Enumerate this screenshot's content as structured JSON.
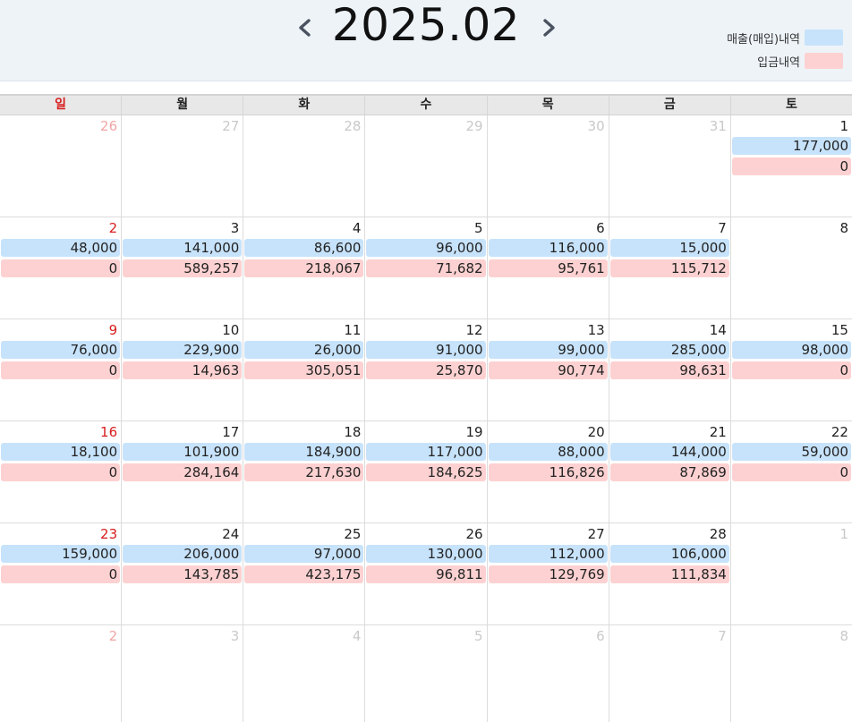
{
  "header": {
    "title": "2025.02",
    "prev_icon": "chevron-left-icon",
    "next_icon": "chevron-right-icon"
  },
  "legend": [
    {
      "label": "매출(매입)내역",
      "color": "#c7e3fb"
    },
    {
      "label": "입금내역",
      "color": "#fdd1d1"
    }
  ],
  "weekdays": [
    "일",
    "월",
    "화",
    "수",
    "목",
    "금",
    "토"
  ],
  "colors": {
    "sales": "#c7e3fb",
    "deposit": "#fdd1d1",
    "sunday": "#d71d1d"
  },
  "weeks": [
    [
      {
        "day": "26",
        "other": true
      },
      {
        "day": "27",
        "other": true
      },
      {
        "day": "28",
        "other": true
      },
      {
        "day": "29",
        "other": true
      },
      {
        "day": "30",
        "other": true
      },
      {
        "day": "31",
        "other": true
      },
      {
        "day": "1",
        "sales": "177,000",
        "deposit": "0"
      }
    ],
    [
      {
        "day": "2",
        "sales": "48,000",
        "deposit": "0"
      },
      {
        "day": "3",
        "sales": "141,000",
        "deposit": "589,257"
      },
      {
        "day": "4",
        "sales": "86,600",
        "deposit": "218,067"
      },
      {
        "day": "5",
        "sales": "96,000",
        "deposit": "71,682"
      },
      {
        "day": "6",
        "sales": "116,000",
        "deposit": "95,761"
      },
      {
        "day": "7",
        "sales": "15,000",
        "deposit": "115,712"
      },
      {
        "day": "8"
      }
    ],
    [
      {
        "day": "9",
        "sales": "76,000",
        "deposit": "0"
      },
      {
        "day": "10",
        "sales": "229,900",
        "deposit": "14,963"
      },
      {
        "day": "11",
        "sales": "26,000",
        "deposit": "305,051"
      },
      {
        "day": "12",
        "sales": "91,000",
        "deposit": "25,870"
      },
      {
        "day": "13",
        "sales": "99,000",
        "deposit": "90,774"
      },
      {
        "day": "14",
        "sales": "285,000",
        "deposit": "98,631"
      },
      {
        "day": "15",
        "sales": "98,000",
        "deposit": "0"
      }
    ],
    [
      {
        "day": "16",
        "sales": "18,100",
        "deposit": "0"
      },
      {
        "day": "17",
        "sales": "101,900",
        "deposit": "284,164"
      },
      {
        "day": "18",
        "sales": "184,900",
        "deposit": "217,630"
      },
      {
        "day": "19",
        "sales": "117,000",
        "deposit": "184,625"
      },
      {
        "day": "20",
        "sales": "88,000",
        "deposit": "116,826"
      },
      {
        "day": "21",
        "sales": "144,000",
        "deposit": "87,869"
      },
      {
        "day": "22",
        "sales": "59,000",
        "deposit": "0"
      }
    ],
    [
      {
        "day": "23",
        "sales": "159,000",
        "deposit": "0"
      },
      {
        "day": "24",
        "sales": "206,000",
        "deposit": "143,785"
      },
      {
        "day": "25",
        "sales": "97,000",
        "deposit": "423,175"
      },
      {
        "day": "26",
        "sales": "130,000",
        "deposit": "96,811"
      },
      {
        "day": "27",
        "sales": "112,000",
        "deposit": "129,769"
      },
      {
        "day": "28",
        "sales": "106,000",
        "deposit": "111,834"
      },
      {
        "day": "1",
        "other": true
      }
    ],
    [
      {
        "day": "2",
        "other": true
      },
      {
        "day": "3",
        "other": true
      },
      {
        "day": "4",
        "other": true
      },
      {
        "day": "5",
        "other": true
      },
      {
        "day": "6",
        "other": true
      },
      {
        "day": "7",
        "other": true
      },
      {
        "day": "8",
        "other": true
      }
    ]
  ]
}
